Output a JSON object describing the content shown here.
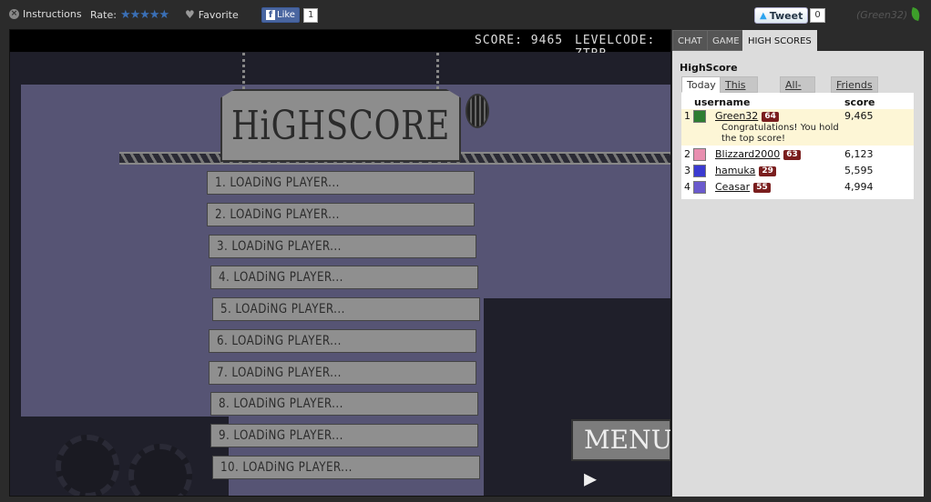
{
  "topbar": {
    "instructions": "Instructions",
    "rate_label": "Rate:",
    "stars": "★★★★★",
    "favorite": "Favorite",
    "like_label": "Like",
    "like_count": "1",
    "tweet_label": "Tweet",
    "tweet_count": "0",
    "user_tag": "(Green32)"
  },
  "hud": {
    "score": "SCORE: 9465",
    "levelcode": "LEVELCODE: ZTBB"
  },
  "game": {
    "sign_title": "HiGHSCORE",
    "rows": [
      "1. LOADiNG PLAYER...",
      "2. LOADiNG PLAYER...",
      "3. LOADiNG PLAYER...",
      "4. LOADiNG PLAYER...",
      "5. LOADiNG PLAYER...",
      "6. LOADiNG PLAYER...",
      "7. LOADiNG PLAYER...",
      "8. LOADiNG PLAYER...",
      "9. LOADiNG PLAYER...",
      "10. LOADiNG PLAYER..."
    ],
    "menu_label": "MENU ▸"
  },
  "panel": {
    "tabs": [
      "CHAT",
      "GAME",
      "HIGH SCORES"
    ],
    "title": "HighScore",
    "subtabs": [
      "Today",
      "This Week",
      "All-Time",
      "Friends"
    ],
    "col_username": "username",
    "col_score": "score",
    "entries": [
      {
        "rank": "1",
        "name": "Green32",
        "level": "64",
        "score": "9,465",
        "avatar_color": "#2e7d32",
        "note": "Congratulations! You hold the top score!"
      },
      {
        "rank": "2",
        "name": "Blizzard2000",
        "level": "63",
        "score": "6,123",
        "avatar_color": "#e88fb0"
      },
      {
        "rank": "3",
        "name": "hamuka",
        "level": "29",
        "score": "5,595",
        "avatar_color": "#3a3ad0"
      },
      {
        "rank": "4",
        "name": "Ceasar",
        "level": "55",
        "score": "4,994",
        "avatar_color": "#6a5acd"
      }
    ]
  }
}
